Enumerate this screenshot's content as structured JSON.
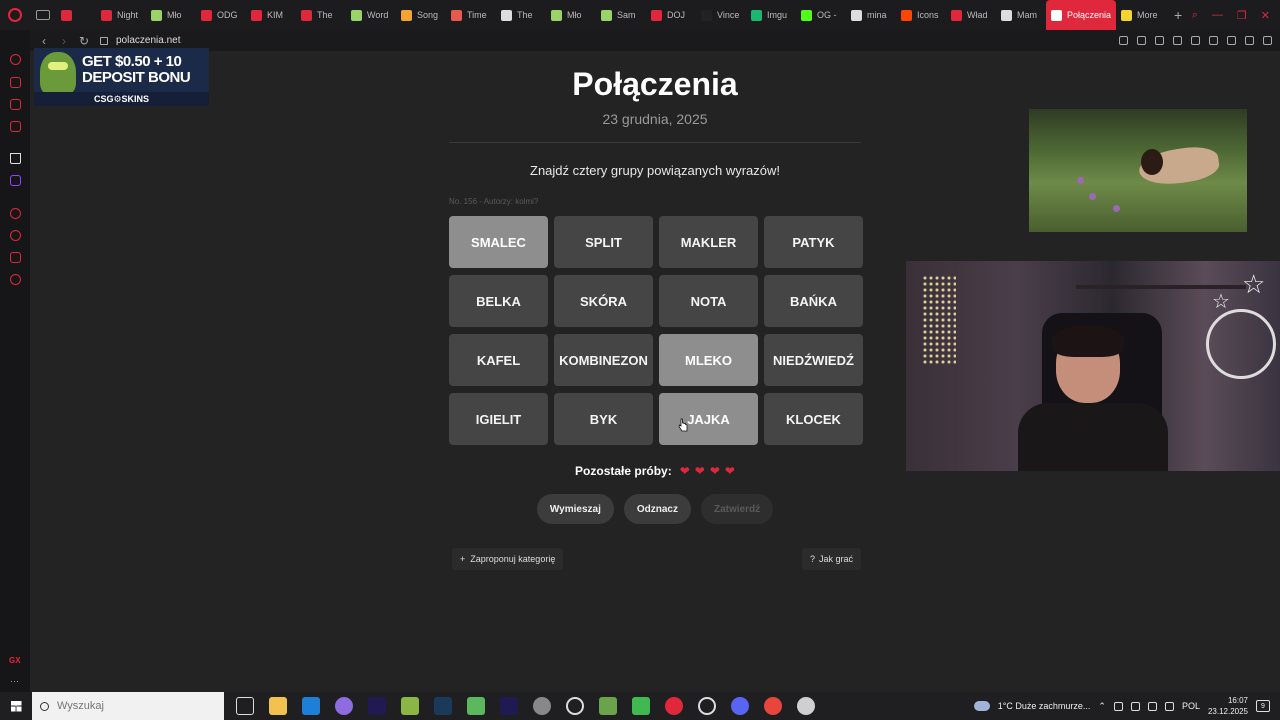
{
  "browser": {
    "tabs": [
      {
        "label": "",
        "color": "#e0283c",
        "icon": "youtube-icon"
      },
      {
        "label": "Night",
        "color": "#e0283c",
        "icon": "youtube-icon"
      },
      {
        "label": "Mło",
        "color": "#9bd36b",
        "icon": "page-icon"
      },
      {
        "label": "ODG",
        "color": "#e0283c",
        "icon": "youtube-icon"
      },
      {
        "label": "KIM",
        "color": "#e0283c",
        "icon": "youtube-icon"
      },
      {
        "label": "The",
        "color": "#e0283c",
        "icon": "youtube-icon"
      },
      {
        "label": "Word",
        "color": "#9bd36b",
        "icon": "page-icon"
      },
      {
        "label": "Song",
        "color": "#f2a531",
        "icon": "page-icon"
      },
      {
        "label": "Time",
        "color": "#e85a4f",
        "icon": "page-icon"
      },
      {
        "label": "The",
        "color": "#dddddd",
        "icon": "page-icon"
      },
      {
        "label": "Mło",
        "color": "#9bd36b",
        "icon": "page-icon"
      },
      {
        "label": "Sam",
        "color": "#9bd36b",
        "icon": "page-icon"
      },
      {
        "label": "DOJ",
        "color": "#e0283c",
        "icon": "youtube-icon"
      },
      {
        "label": "Vince",
        "color": "#222222",
        "icon": "tiktok-icon"
      },
      {
        "label": "Imgu",
        "color": "#1bb76e",
        "icon": "imgur-icon"
      },
      {
        "label": "OG -",
        "color": "#53fc18",
        "icon": "kick-icon"
      },
      {
        "label": "mina",
        "color": "#dddddd",
        "icon": "page-icon"
      },
      {
        "label": "Icons",
        "color": "#ff4500",
        "icon": "reddit-icon"
      },
      {
        "label": "Wład",
        "color": "#e0283c",
        "icon": "page-icon"
      },
      {
        "label": "Mam",
        "color": "#dddddd",
        "icon": "x-icon"
      },
      {
        "label": "Połączenia",
        "color": "#ffffff",
        "icon": "page-icon",
        "active": true
      },
      {
        "label": "More",
        "color": "#f2d531",
        "icon": "page-icon"
      }
    ],
    "url": "polaczenia.net"
  },
  "ad": {
    "line1": "GET $0.50 + 10",
    "line2": "DEPOSIT BONU",
    "brand": "CSG⚙SKINS"
  },
  "game": {
    "title": "Połączenia",
    "date": "23 grudnia, 2025",
    "subtitle": "Znajdź cztery grupy powiązanych wyrazów!",
    "credits": "No. 156 - Autorzy: kolmi?",
    "tiles": [
      {
        "word": "SMALEC",
        "selected": true
      },
      {
        "word": "SPLIT",
        "selected": false
      },
      {
        "word": "MAKLER",
        "selected": false
      },
      {
        "word": "PATYK",
        "selected": false
      },
      {
        "word": "BELKA",
        "selected": false
      },
      {
        "word": "SKÓRA",
        "selected": false
      },
      {
        "word": "NOTA",
        "selected": false
      },
      {
        "word": "BAŃKA",
        "selected": false
      },
      {
        "word": "KAFEL",
        "selected": false
      },
      {
        "word": "KOMBINEZON",
        "selected": false
      },
      {
        "word": "MLEKO",
        "selected": true
      },
      {
        "word": "NIEDŹWIEDŹ",
        "selected": false
      },
      {
        "word": "IGIELIT",
        "selected": false
      },
      {
        "word": "BYK",
        "selected": false
      },
      {
        "word": "JAJKA",
        "selected": true
      },
      {
        "word": "KLOCEK",
        "selected": false
      }
    ],
    "attempts_label": "Pozostałe próby:",
    "attempts_remaining": 4,
    "heart_color": "#e0283c",
    "buttons": {
      "shuffle": "Wymieszaj",
      "deselect": "Odznacz",
      "submit": "Zatwierdź"
    },
    "suggest_label": "Zaproponuj kategorię",
    "howto_label": "Jak grać"
  },
  "taskbar": {
    "search_placeholder": "Wyszukaj",
    "weather": "1°C  Duże zachmurze...",
    "language": "POL",
    "time": "16:07",
    "date": "23.12.2025",
    "notifications": "9"
  }
}
